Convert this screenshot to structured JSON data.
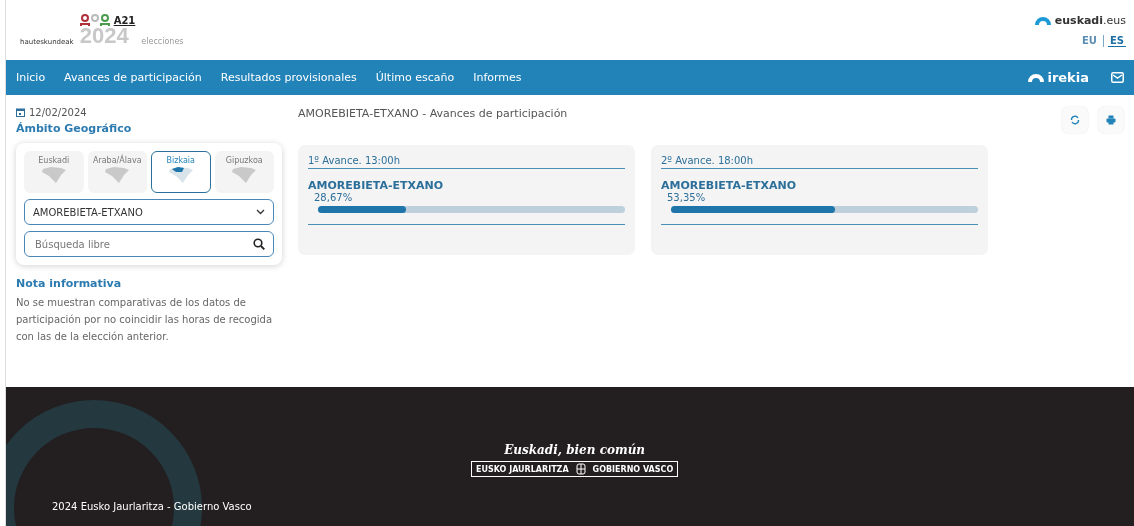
{
  "header": {
    "logo": {
      "site": "hauteskundeak",
      "code": "A21",
      "year": "2024",
      "caption": "elecciones"
    },
    "portal": {
      "name": "euskadi",
      "suffix": ".eus"
    },
    "languages": [
      {
        "label": "EU",
        "selected": false
      },
      {
        "label": "ES",
        "selected": true
      }
    ]
  },
  "nav": {
    "items": [
      "Inicio",
      "Avances de participación",
      "Resultados provisionales",
      "Último escaño",
      "Informes"
    ],
    "brand": "irekia"
  },
  "sidebar": {
    "date": "12/02/2024",
    "title": "Ámbito Geográfico",
    "regions": [
      {
        "label": "Euskadi",
        "selected": false
      },
      {
        "label": "Araba/Álava",
        "selected": false
      },
      {
        "label": "Bizkaia",
        "selected": true
      },
      {
        "label": "Gipuzkoa",
        "selected": false
      }
    ],
    "municipality": "AMOREBIETA-ETXANO",
    "search": {
      "placeholder": "Búsqueda libre"
    },
    "note": {
      "title": "Nota informativa",
      "text": "No se muestran comparativas de los datos de participación por no coincidir las horas de recogida con las de la elección anterior."
    }
  },
  "main": {
    "title": "AMOREBIETA-ETXANO - Avances de participación",
    "cards": [
      {
        "title": "1º Avance. 13:00h",
        "place": "AMOREBIETA-ETXANO",
        "reading": "28,67%",
        "level": 0.2867
      },
      {
        "title": "2º Avance. 18:00h",
        "place": "AMOREBIETA-ETXANO",
        "reading": "53,35%",
        "level": 0.5335
      }
    ]
  },
  "footer": {
    "slogan": "Euskadi, bien común",
    "seal": [
      "EUSKO JAURLARITZA",
      "GOBIERNO VASCO"
    ],
    "copyright": "2024 Eusko Jaurlaritza - Gobierno Vasco"
  }
}
